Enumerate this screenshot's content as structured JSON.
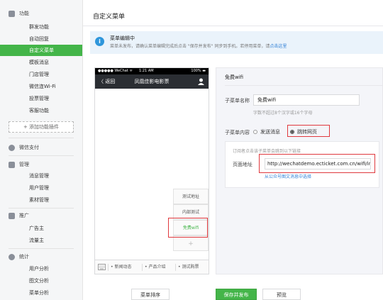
{
  "sidebar": {
    "sections": [
      {
        "title": "功能",
        "icon": "grid-icon",
        "items": [
          "群发功能",
          "自动回复",
          "自定义菜单",
          "模板消息",
          "门店管理",
          "微信连Wi-Fi",
          "投票管理",
          "客服功能"
        ]
      },
      {
        "title": "微信支付",
        "icon": "check-circle-icon",
        "items": []
      },
      {
        "title": "管理",
        "icon": "chat-icon",
        "items": [
          "消息管理",
          "用户管理",
          "素材管理"
        ]
      },
      {
        "title": "推广",
        "icon": "megaphone-icon",
        "items": [
          "广告主",
          "流量主"
        ]
      },
      {
        "title": "统计",
        "icon": "pie-chart-icon",
        "items": [
          "用户分析",
          "图文分析",
          "菜单分析"
        ]
      }
    ],
    "active_item": "自定义菜单",
    "add_plugin_label": "+ 添加功能插件"
  },
  "page": {
    "title": "自定义菜单"
  },
  "notice": {
    "title": "菜单编辑中",
    "desc": "菜单未发布，请确认菜单编辑完成后点击 \"保存并发布\" 同步到手机。若停用菜单，请",
    "link": "点击这里"
  },
  "phone": {
    "status_left": "●●●●● WeChat ᯤ",
    "status_time": "1:21 AM",
    "status_right": "100% ▬",
    "back_label": "〈 返回",
    "title": "凤凰佳影电影票",
    "submenu": [
      "测试地址",
      "内部测试",
      "免费wifi",
      "+"
    ],
    "menubar": [
      "新闻动态",
      "产品介绍",
      "测试购票"
    ]
  },
  "editor": {
    "title": "免费wifi",
    "name_label": "子菜单名称",
    "name_value": "免费wifi",
    "name_hint": "字数不超过8个汉字或16个字母",
    "content_label": "子菜单内容",
    "options": [
      "发送消息",
      "跳转网页"
    ],
    "selected_option": "跳转网页",
    "url_tip": "订阅者点击该子菜单会跳到以下链接",
    "url_label": "页面地址",
    "url_value": "http://wechatdemo.ecticket.com.cn/wifi/in",
    "url_link": "从公众号图文消息中选择"
  },
  "footer": {
    "sort_label": "菜单排序",
    "publish_label": "保存并发布",
    "preview_label": "预览"
  },
  "colors": {
    "accent": "#44b549",
    "info": "#2e96db",
    "highlight": "#e0393e",
    "link": "#2e7fd6"
  }
}
